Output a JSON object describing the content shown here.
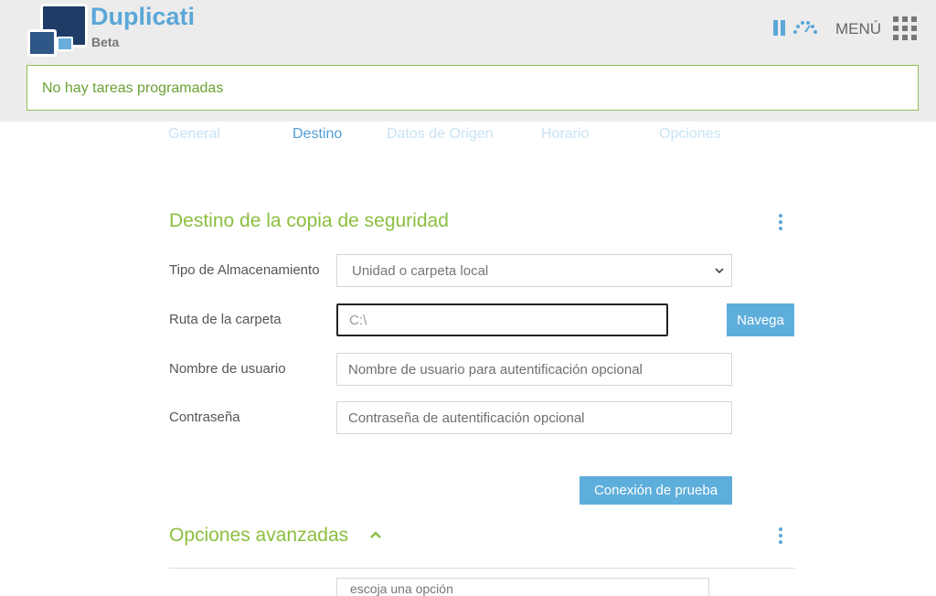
{
  "app": {
    "name": "Duplicati",
    "channel": "Beta"
  },
  "header": {
    "menu_label": "MENÚ"
  },
  "status": {
    "message": "No hay tareas programadas"
  },
  "tabs": [
    {
      "label": "General",
      "active": false
    },
    {
      "label": "Destino",
      "active": true
    },
    {
      "label": "Datos de Origen",
      "active": false
    },
    {
      "label": "Horario",
      "active": false
    },
    {
      "label": "Opciones",
      "active": false
    }
  ],
  "destination": {
    "title": "Destino de la copia de seguridad",
    "storage_type": {
      "label": "Tipo de Almacenamiento",
      "value": "Unidad o carpeta local"
    },
    "folder_path": {
      "label": "Ruta de la carpeta",
      "value": "C:\\",
      "browse_label": "Navega"
    },
    "username": {
      "label": "Nombre de usuario",
      "placeholder": "Nombre de usuario para autentificación opcional"
    },
    "password": {
      "label": "Contraseña",
      "placeholder": "Contraseña de autentificación opcional"
    },
    "test_button": "Conexión de prueba"
  },
  "advanced": {
    "title": "Opciones avanzadas",
    "select_placeholder": "escoja una opción"
  },
  "colors": {
    "accent_blue": "#5aa7d8",
    "accent_green": "#8cbf3f",
    "header_bg": "#ececec"
  }
}
